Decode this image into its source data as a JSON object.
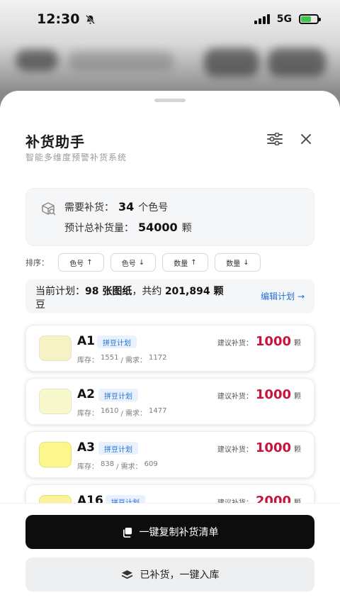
{
  "status": {
    "time": "12:30",
    "network": "5G"
  },
  "sheet": {
    "title": "补货助手",
    "subtitle": "智能多维度预警补货系统"
  },
  "summary": {
    "line1_label": "需要补货：",
    "line1_value": "34",
    "line1_unit": "个色号",
    "line2_label": "预计总补货量：",
    "line2_value": "54000",
    "line2_unit": "颗"
  },
  "sort": {
    "label": "排序：",
    "options": [
      {
        "label": "色号",
        "arrow": "↑"
      },
      {
        "label": "色号",
        "arrow": "↓"
      },
      {
        "label": "数量",
        "arrow": "↑"
      },
      {
        "label": "数量",
        "arrow": "↓"
      }
    ]
  },
  "plan": {
    "prefix": "当前计划：",
    "bold1": "98 张图纸",
    "mid": "，共约 ",
    "bold2": "201,894 颗",
    "suffix": "豆",
    "edit_link": "编辑计划 →"
  },
  "items": [
    {
      "code": "A1",
      "tag": "拼豆计划",
      "stock_label": "库存：",
      "stock": "1551",
      "need_label": "/ 需求：",
      "need": "1172",
      "suggest_label": "建议补货：",
      "suggest": "1000",
      "unit": "颗",
      "color": "#f7f2c6"
    },
    {
      "code": "A2",
      "tag": "拼豆计划",
      "stock_label": "库存：",
      "stock": "1610",
      "need_label": "/ 需求：",
      "need": "1477",
      "suggest_label": "建议补货：",
      "suggest": "1000",
      "unit": "颗",
      "color": "#f8f8cd"
    },
    {
      "code": "A3",
      "tag": "拼豆计划",
      "stock_label": "库存：",
      "stock": "838",
      "need_label": "/ 需求：",
      "need": "609",
      "suggest_label": "建议补货：",
      "suggest": "1000",
      "unit": "颗",
      "color": "#fbf78d"
    },
    {
      "code": "A16",
      "tag": "拼豆计划",
      "stock_label": "",
      "stock": "",
      "need_label": "",
      "need": "",
      "suggest_label": "建议补货：",
      "suggest": "2000",
      "unit": "颗",
      "color": "#faf39a"
    }
  ],
  "actions": {
    "copy_list": "一键复制补货清单",
    "restock": "已补货，一键入库"
  }
}
